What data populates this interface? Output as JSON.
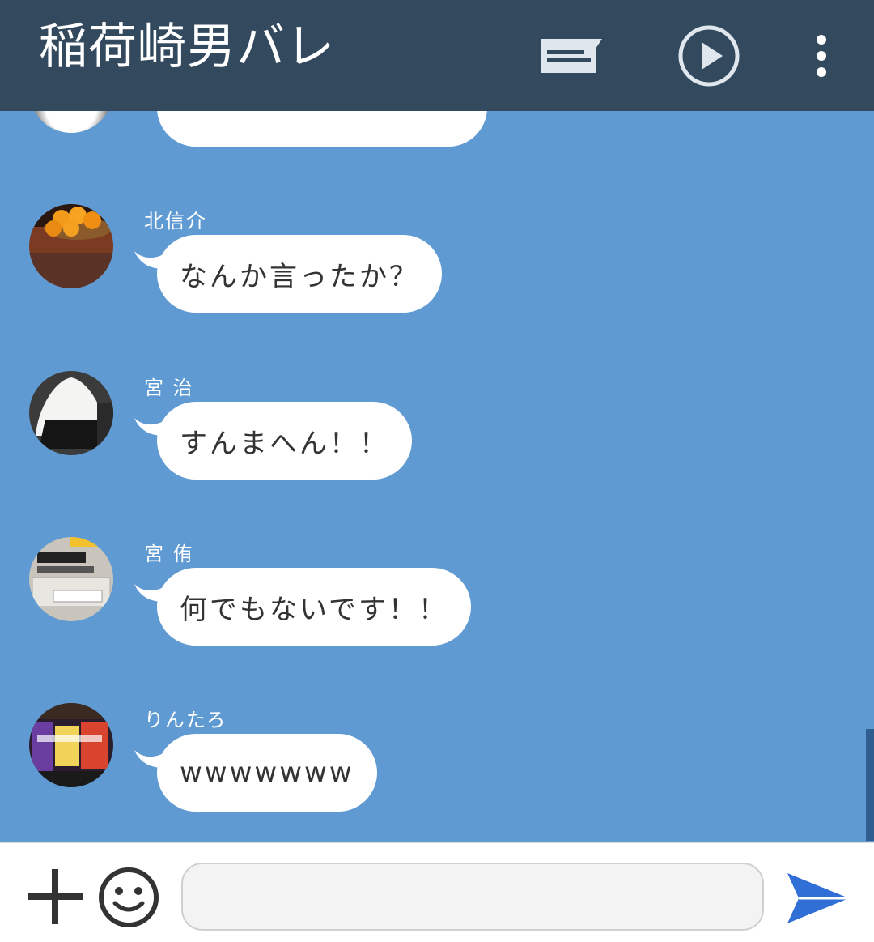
{
  "header": {
    "title": "稲荷崎男バレ",
    "icons": [
      "note-icon",
      "play-icon",
      "more-vert-icon"
    ]
  },
  "messages": [
    {
      "sender": "北信介",
      "text": "なんか言ったか？",
      "avatar": "mandarin-oranges"
    },
    {
      "sender": "宮 治",
      "text": "すんまへん！！",
      "avatar": "onigiri"
    },
    {
      "sender": "宮 侑",
      "text": "何でもないです！！",
      "avatar": "trophy-plaque"
    },
    {
      "sender": "りんたろ",
      "text": "wwwwwww",
      "avatar": "colorful-shop"
    }
  ],
  "input": {
    "placeholder": "",
    "value": ""
  },
  "colors": {
    "header_bg": "#334a5e",
    "chat_bg": "#5f9ad2",
    "send_icon": "#2f6fd6"
  }
}
